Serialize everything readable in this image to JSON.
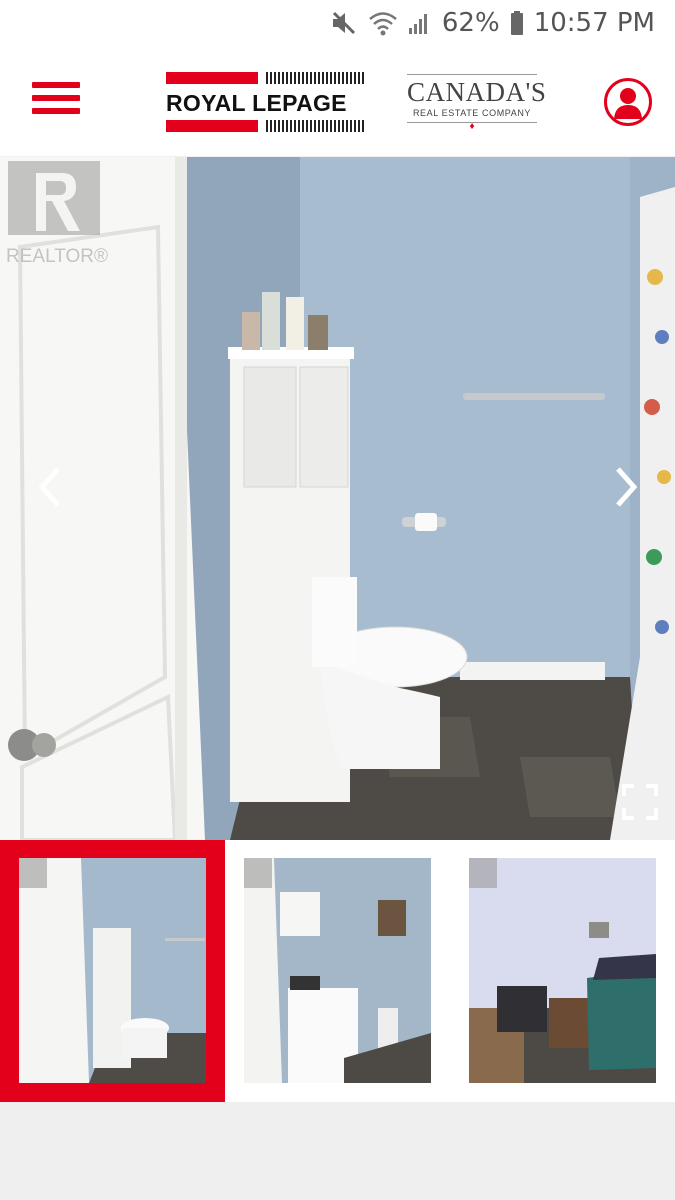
{
  "status_bar": {
    "battery_percent": "62%",
    "time": "10:57 PM",
    "icons": [
      "mute-icon",
      "wifi-icon",
      "signal-icon",
      "battery-icon"
    ]
  },
  "header": {
    "menu_icon": "hamburger-menu-icon",
    "brand_left": "ROYAL LEPAGE",
    "brand_right_big": "CANADA'S",
    "brand_right_small": "REAL ESTATE COMPANY",
    "profile_icon": "user-profile-icon",
    "accent_color": "#e2001a"
  },
  "gallery": {
    "watermark": "REALTOR®",
    "prev_icon": "chevron-left-icon",
    "next_icon": "chevron-right-icon",
    "fullscreen_icon": "fullscreen-expand-icon",
    "current_photo": "bathroom",
    "thumbnails": [
      {
        "scene": "bathroom",
        "active": true
      },
      {
        "scene": "laundry",
        "active": false
      },
      {
        "scene": "bedroom",
        "active": false
      }
    ]
  }
}
